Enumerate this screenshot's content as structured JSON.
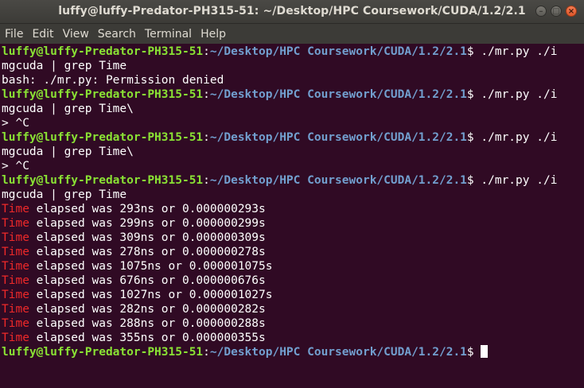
{
  "window": {
    "title": "luffy@luffy-Predator-PH315-51: ~/Desktop/HPC Coursework/CUDA/1.2/2.1",
    "minimize_glyph": "–",
    "maximize_glyph": "□",
    "close_glyph": "×"
  },
  "menu": [
    "File",
    "Edit",
    "View",
    "Search",
    "Terminal",
    "Help"
  ],
  "prompt": {
    "user_host": "luffy@luffy-Predator-PH315-51",
    "colon": ":",
    "path": "~/Desktop/HPC Coursework/CUDA/1.2/2.1",
    "dollar": "$ "
  },
  "colors": {
    "background": "#300a24",
    "prompt_user": "#8ae234",
    "prompt_path": "#729fcf",
    "grep_match": "#ef2929"
  },
  "lines": [
    {
      "type": "prompt",
      "cmd": "./mr.py ./i"
    },
    {
      "type": "text",
      "text": "mgcuda | grep Time"
    },
    {
      "type": "text",
      "text": "bash: ./mr.py: Permission denied"
    },
    {
      "type": "prompt",
      "cmd": "./mr.py ./i"
    },
    {
      "type": "text",
      "text": "mgcuda | grep Time\\"
    },
    {
      "type": "text",
      "text": "> ^C"
    },
    {
      "type": "prompt",
      "cmd": "./mr.py ./i"
    },
    {
      "type": "text",
      "text": "mgcuda | grep Time\\"
    },
    {
      "type": "text",
      "text": "> ^C"
    },
    {
      "type": "prompt",
      "cmd": "./mr.py ./i"
    },
    {
      "type": "text",
      "text": "mgcuda | grep Time"
    },
    {
      "type": "match",
      "hit": "Time",
      "rest": " elapsed was 293ns or 0.000000293s"
    },
    {
      "type": "match",
      "hit": "Time",
      "rest": " elapsed was 299ns or 0.000000299s"
    },
    {
      "type": "match",
      "hit": "Time",
      "rest": " elapsed was 309ns or 0.000000309s"
    },
    {
      "type": "match",
      "hit": "Time",
      "rest": " elapsed was 278ns or 0.000000278s"
    },
    {
      "type": "match",
      "hit": "Time",
      "rest": " elapsed was 1075ns or 0.000001075s"
    },
    {
      "type": "match",
      "hit": "Time",
      "rest": " elapsed was 676ns or 0.000000676s"
    },
    {
      "type": "match",
      "hit": "Time",
      "rest": " elapsed was 1027ns or 0.000001027s"
    },
    {
      "type": "match",
      "hit": "Time",
      "rest": " elapsed was 282ns or 0.000000282s"
    },
    {
      "type": "match",
      "hit": "Time",
      "rest": " elapsed was 288ns or 0.000000288s"
    },
    {
      "type": "match",
      "hit": "Time",
      "rest": " elapsed was 355ns or 0.000000355s"
    },
    {
      "type": "prompt",
      "cmd": "",
      "cursor": true
    }
  ]
}
